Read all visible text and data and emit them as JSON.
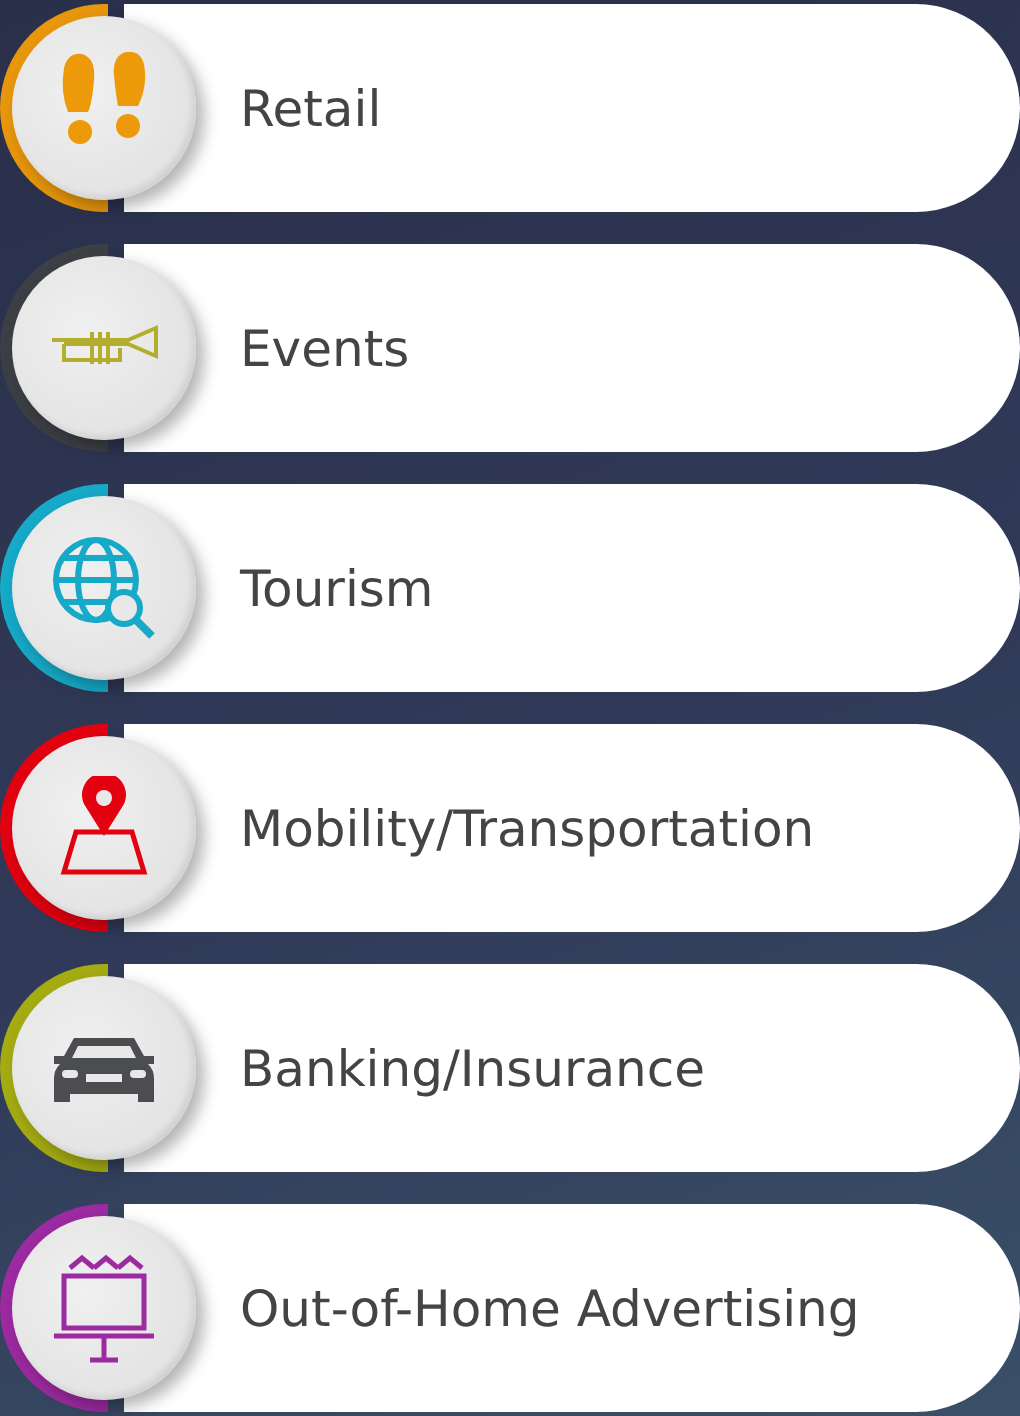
{
  "items": [
    {
      "label": "Retail",
      "kind": "footprints",
      "color": "#e8960c"
    },
    {
      "label": "Events",
      "kind": "trumpet",
      "color": "#3c3f44"
    },
    {
      "label": "Tourism",
      "kind": "globe",
      "color": "#16a9c8"
    },
    {
      "label": "Mobility/Transportation",
      "kind": "map-pin",
      "color": "#e3000f"
    },
    {
      "label": "Banking/Insurance",
      "kind": "car",
      "color": "#a5ac12"
    },
    {
      "label": "Out-of-Home Advertising",
      "kind": "billboard",
      "color": "#9c2aa0"
    }
  ]
}
